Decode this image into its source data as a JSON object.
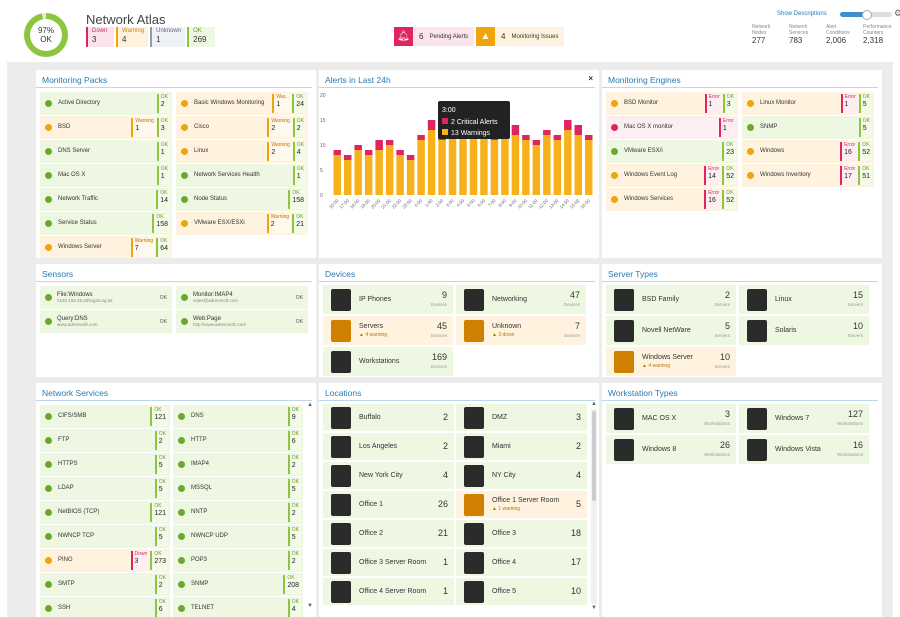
{
  "header": {
    "health_percent": "97%",
    "health_status": "OK",
    "app_title": "Network Atlas",
    "badges": [
      {
        "label": "Down",
        "value": "3"
      },
      {
        "label": "Warning",
        "value": "4"
      },
      {
        "label": "Unknown",
        "value": "1"
      },
      {
        "label": "OK",
        "value": "269"
      }
    ],
    "pending_alerts_count": "6",
    "pending_alerts_label": "Pending Alerts",
    "monitoring_issues_count": "4",
    "monitoring_issues_label": "Monitoring Issues",
    "show_descriptions": "Show Descriptions",
    "stats": [
      {
        "label": "Network Nodes",
        "value": "277"
      },
      {
        "label": "Network Services",
        "value": "783"
      },
      {
        "label": "Alert Conditions",
        "value": "2,006"
      },
      {
        "label": "Performance Counters",
        "value": "2,318"
      }
    ]
  },
  "monitoring_packs": {
    "title": "Monitoring Packs",
    "items": [
      {
        "label": "Active Directory",
        "status": "ok",
        "badges": [
          {
            "t": "g",
            "l": "OK",
            "v": "2"
          }
        ]
      },
      {
        "label": "Basic Windows Monitoring",
        "status": "warn",
        "badges": [
          {
            "t": "o",
            "l": "War...",
            "v": "1"
          },
          {
            "t": "g",
            "l": "OK",
            "v": "24"
          }
        ]
      },
      {
        "label": "BSD",
        "status": "warn",
        "badges": [
          {
            "t": "o",
            "l": "Warning",
            "v": "1"
          },
          {
            "t": "g",
            "l": "OK",
            "v": "3"
          }
        ]
      },
      {
        "label": "Cisco",
        "status": "warn",
        "badges": [
          {
            "t": "o",
            "l": "Warning",
            "v": "2"
          },
          {
            "t": "g",
            "l": "OK",
            "v": "2"
          }
        ]
      },
      {
        "label": "DNS Server",
        "status": "ok",
        "badges": [
          {
            "t": "g",
            "l": "OK",
            "v": "1"
          }
        ]
      },
      {
        "label": "Linux",
        "status": "warn",
        "badges": [
          {
            "t": "o",
            "l": "Warning",
            "v": "2"
          },
          {
            "t": "g",
            "l": "OK",
            "v": "4"
          }
        ]
      },
      {
        "label": "Mac OS X",
        "status": "ok",
        "badges": [
          {
            "t": "g",
            "l": "OK",
            "v": "1"
          }
        ]
      },
      {
        "label": "Network Services Health",
        "status": "ok",
        "badges": [
          {
            "t": "g",
            "l": "OK",
            "v": "1"
          }
        ]
      },
      {
        "label": "Network Traffic",
        "status": "ok",
        "badges": [
          {
            "t": "g",
            "l": "OK",
            "v": "14"
          }
        ]
      },
      {
        "label": "Node Status",
        "status": "ok",
        "badges": [
          {
            "t": "g",
            "l": "OK",
            "v": "158"
          }
        ]
      },
      {
        "label": "Service Status",
        "status": "ok",
        "badges": [
          {
            "t": "g",
            "l": "OK",
            "v": "158"
          }
        ]
      },
      {
        "label": "VMware ESX/ESXi",
        "status": "warn",
        "badges": [
          {
            "t": "o",
            "l": "Warning",
            "v": "2"
          },
          {
            "t": "g",
            "l": "OK",
            "v": "21"
          }
        ]
      },
      {
        "label": "Windows Server",
        "status": "warn",
        "badges": [
          {
            "t": "o",
            "l": "Warning",
            "v": "7"
          },
          {
            "t": "g",
            "l": "OK",
            "v": "64"
          }
        ]
      }
    ]
  },
  "alerts_chart": {
    "title": "Alerts in Last 24h",
    "close": "×",
    "tooltip_time": "3:00",
    "tooltip_critical": "2 Critical Alerts",
    "tooltip_warnings": "13 Warnings",
    "colors": {
      "critical": "#e0245e",
      "warning": "#f7b21b"
    }
  },
  "chart_data": {
    "type": "bar",
    "stacked": true,
    "ylim": [
      0,
      20
    ],
    "yticks": [
      "0",
      "5",
      "10",
      "15",
      "20"
    ],
    "categories": [
      "16:00",
      "17:00",
      "18:00",
      "19:00",
      "20:00",
      "21:00",
      "22:00",
      "23:00",
      "0:00",
      "1:00",
      "2:00",
      "3:00",
      "4:00",
      "5:00",
      "6:00",
      "7:00",
      "8:00",
      "9:00",
      "10:00",
      "11:00",
      "12:00",
      "13:00",
      "14:00",
      "15:00",
      "16:00"
    ],
    "series": [
      {
        "name": "Warnings",
        "values": [
          8,
          7,
          9,
          8,
          9,
          10,
          8,
          7,
          11,
          13,
          11,
          13,
          14,
          12,
          13,
          11,
          12,
          12,
          11,
          10,
          12,
          11,
          13,
          12,
          11
        ]
      },
      {
        "name": "Critical Alerts",
        "values": [
          1,
          1,
          1,
          1,
          2,
          1,
          1,
          1,
          1,
          2,
          1,
          2,
          2,
          3,
          2,
          2,
          1,
          2,
          1,
          1,
          1,
          1,
          2,
          2,
          1
        ]
      }
    ]
  },
  "monitoring_engines": {
    "title": "Monitoring Engines",
    "items": [
      {
        "label": "BSD Monitor",
        "status": "warn",
        "badges": [
          {
            "t": "r",
            "l": "Error",
            "v": "1"
          },
          {
            "t": "g",
            "l": "OK",
            "v": "3"
          }
        ]
      },
      {
        "label": "Linux Monitor",
        "status": "warn",
        "badges": [
          {
            "t": "r",
            "l": "Error",
            "v": "1"
          },
          {
            "t": "g",
            "l": "OK",
            "v": "5"
          }
        ]
      },
      {
        "label": "Mac OS X monitor",
        "status": "err",
        "badges": [
          {
            "t": "r",
            "l": "Error",
            "v": "1"
          }
        ]
      },
      {
        "label": "SNMP",
        "status": "ok",
        "badges": [
          {
            "t": "g",
            "l": "OK",
            "v": "5"
          }
        ]
      },
      {
        "label": "VMware ESX/i",
        "status": "ok",
        "badges": [
          {
            "t": "g",
            "l": "OK",
            "v": "23"
          }
        ]
      },
      {
        "label": "Windows",
        "status": "warn",
        "badges": [
          {
            "t": "r",
            "l": "Error",
            "v": "16"
          },
          {
            "t": "g",
            "l": "OK",
            "v": "52"
          }
        ]
      },
      {
        "label": "Windows Event Log",
        "status": "warn",
        "badges": [
          {
            "t": "r",
            "l": "Error",
            "v": "14"
          },
          {
            "t": "g",
            "l": "OK",
            "v": "52"
          }
        ]
      },
      {
        "label": "Windows Inventory",
        "status": "warn",
        "badges": [
          {
            "t": "r",
            "l": "Error",
            "v": "17"
          },
          {
            "t": "g",
            "l": "OK",
            "v": "51"
          }
        ]
      },
      {
        "label": "Windows Services",
        "status": "warn",
        "badges": [
          {
            "t": "r",
            "l": "Error",
            "v": "16"
          },
          {
            "t": "g",
            "l": "OK",
            "v": "52"
          }
        ]
      }
    ]
  },
  "sensors": {
    "title": "Sensors",
    "items": [
      {
        "name": "File:Windows",
        "desc": "\\\\192.168.25.20\\logs\\Log.txt",
        "status": "OK"
      },
      {
        "name": "Monitor:IMAP4",
        "desc": "sales@adremsoft.com",
        "status": "OK"
      },
      {
        "name": "Query:DNS",
        "desc": "www.adremsoft.com",
        "status": "OK"
      },
      {
        "name": "Web:Page",
        "desc": "http://www.adremsoft.com/",
        "status": "OK"
      }
    ]
  },
  "devices": {
    "title": "Devices",
    "items": [
      {
        "name": "IP Phones",
        "count": "9",
        "unit": "Devices",
        "note": "",
        "status": "ok"
      },
      {
        "name": "Networking",
        "count": "47",
        "unit": "Devices",
        "note": "",
        "status": "ok"
      },
      {
        "name": "Servers",
        "count": "45",
        "unit": "Devices",
        "note": "4 warning",
        "status": "warn"
      },
      {
        "name": "Unknown",
        "count": "7",
        "unit": "Devices",
        "note": "3 down",
        "status": "warn"
      },
      {
        "name": "Workstations",
        "count": "169",
        "unit": "Devices",
        "note": "",
        "status": "ok"
      }
    ]
  },
  "server_types": {
    "title": "Server Types",
    "items": [
      {
        "name": "BSD Family",
        "count": "2",
        "unit": "Servers",
        "note": "",
        "status": "ok"
      },
      {
        "name": "Linux",
        "count": "15",
        "unit": "Servers",
        "note": "",
        "status": "ok"
      },
      {
        "name": "Novell NetWare",
        "count": "5",
        "unit": "Servers",
        "note": "",
        "status": "ok"
      },
      {
        "name": "Solaris",
        "count": "10",
        "unit": "Servers",
        "note": "",
        "status": "ok"
      },
      {
        "name": "Windows Server",
        "count": "10",
        "unit": "Servers",
        "note": "4 warning",
        "status": "warn"
      }
    ]
  },
  "network_services": {
    "title": "Network Services",
    "items": [
      {
        "label": "CIFS/SMB",
        "status": "ok",
        "badges": [
          {
            "t": "g",
            "l": "OK",
            "v": "121"
          }
        ]
      },
      {
        "label": "DNS",
        "status": "ok",
        "badges": [
          {
            "t": "g",
            "l": "OK",
            "v": "9"
          }
        ]
      },
      {
        "label": "FTP",
        "status": "ok",
        "badges": [
          {
            "t": "g",
            "l": "OK",
            "v": "2"
          }
        ]
      },
      {
        "label": "HTTP",
        "status": "ok",
        "badges": [
          {
            "t": "g",
            "l": "OK",
            "v": "6"
          }
        ]
      },
      {
        "label": "HTTPS",
        "status": "ok",
        "badges": [
          {
            "t": "g",
            "l": "OK",
            "v": "5"
          }
        ]
      },
      {
        "label": "IMAP4",
        "status": "ok",
        "badges": [
          {
            "t": "g",
            "l": "OK",
            "v": "2"
          }
        ]
      },
      {
        "label": "LDAP",
        "status": "ok",
        "badges": [
          {
            "t": "g",
            "l": "OK",
            "v": "5"
          }
        ]
      },
      {
        "label": "MSSQL",
        "status": "ok",
        "badges": [
          {
            "t": "g",
            "l": "OK",
            "v": "5"
          }
        ]
      },
      {
        "label": "NetBIOS (TCP)",
        "status": "ok",
        "badges": [
          {
            "t": "g",
            "l": "OK",
            "v": "121"
          }
        ]
      },
      {
        "label": "NNTP",
        "status": "ok",
        "badges": [
          {
            "t": "g",
            "l": "OK",
            "v": "2"
          }
        ]
      },
      {
        "label": "NWNCP TCP",
        "status": "ok",
        "badges": [
          {
            "t": "g",
            "l": "OK",
            "v": "5"
          }
        ]
      },
      {
        "label": "NWNCP UDP",
        "status": "ok",
        "badges": [
          {
            "t": "g",
            "l": "OK",
            "v": "5"
          }
        ]
      },
      {
        "label": "PING",
        "status": "warn",
        "badges": [
          {
            "t": "r",
            "l": "Down",
            "v": "3"
          },
          {
            "t": "g",
            "l": "OK",
            "v": "273"
          }
        ]
      },
      {
        "label": "POP3",
        "status": "ok",
        "badges": [
          {
            "t": "g",
            "l": "OK",
            "v": "2"
          }
        ]
      },
      {
        "label": "SMTP",
        "status": "ok",
        "badges": [
          {
            "t": "g",
            "l": "OK",
            "v": "2"
          }
        ]
      },
      {
        "label": "SNMP",
        "status": "ok",
        "badges": [
          {
            "t": "g",
            "l": "OK",
            "v": "208"
          }
        ]
      },
      {
        "label": "SSH",
        "status": "ok",
        "badges": [
          {
            "t": "g",
            "l": "OK",
            "v": "6"
          }
        ]
      },
      {
        "label": "TELNET",
        "status": "ok",
        "badges": [
          {
            "t": "g",
            "l": "OK",
            "v": "4"
          }
        ]
      }
    ]
  },
  "locations": {
    "title": "Locations",
    "items": [
      {
        "name": "Buffalo",
        "count": "2",
        "note": "",
        "status": "ok"
      },
      {
        "name": "DMZ",
        "count": "3",
        "note": "",
        "status": "ok"
      },
      {
        "name": "Los Angeles",
        "count": "2",
        "note": "",
        "status": "ok"
      },
      {
        "name": "Miami",
        "count": "2",
        "note": "",
        "status": "ok"
      },
      {
        "name": "New York City",
        "count": "4",
        "note": "",
        "status": "ok"
      },
      {
        "name": "NY City",
        "count": "4",
        "note": "",
        "status": "ok"
      },
      {
        "name": "Office 1",
        "count": "26",
        "note": "",
        "status": "ok"
      },
      {
        "name": "Office 1 Server Room",
        "count": "5",
        "note": "1 warning",
        "status": "warn"
      },
      {
        "name": "Office 2",
        "count": "21",
        "note": "",
        "status": "ok"
      },
      {
        "name": "Office 3",
        "count": "18",
        "note": "",
        "status": "ok"
      },
      {
        "name": "Office 3 Server Room",
        "count": "1",
        "note": "",
        "status": "ok"
      },
      {
        "name": "Office 4",
        "count": "17",
        "note": "",
        "status": "ok"
      },
      {
        "name": "Office 4 Server Room",
        "count": "1",
        "note": "",
        "status": "ok"
      },
      {
        "name": "Office 5",
        "count": "10",
        "note": "",
        "status": "ok"
      }
    ]
  },
  "workstation_types": {
    "title": "Workstation Types",
    "items": [
      {
        "name": "MAC OS X",
        "count": "3",
        "unit": "Workstations"
      },
      {
        "name": "Windows 7",
        "count": "127",
        "unit": "Workstations"
      },
      {
        "name": "Windows 8",
        "count": "26",
        "unit": "Workstations"
      },
      {
        "name": "Windows Vista",
        "count": "16",
        "unit": "Workstations"
      }
    ]
  }
}
